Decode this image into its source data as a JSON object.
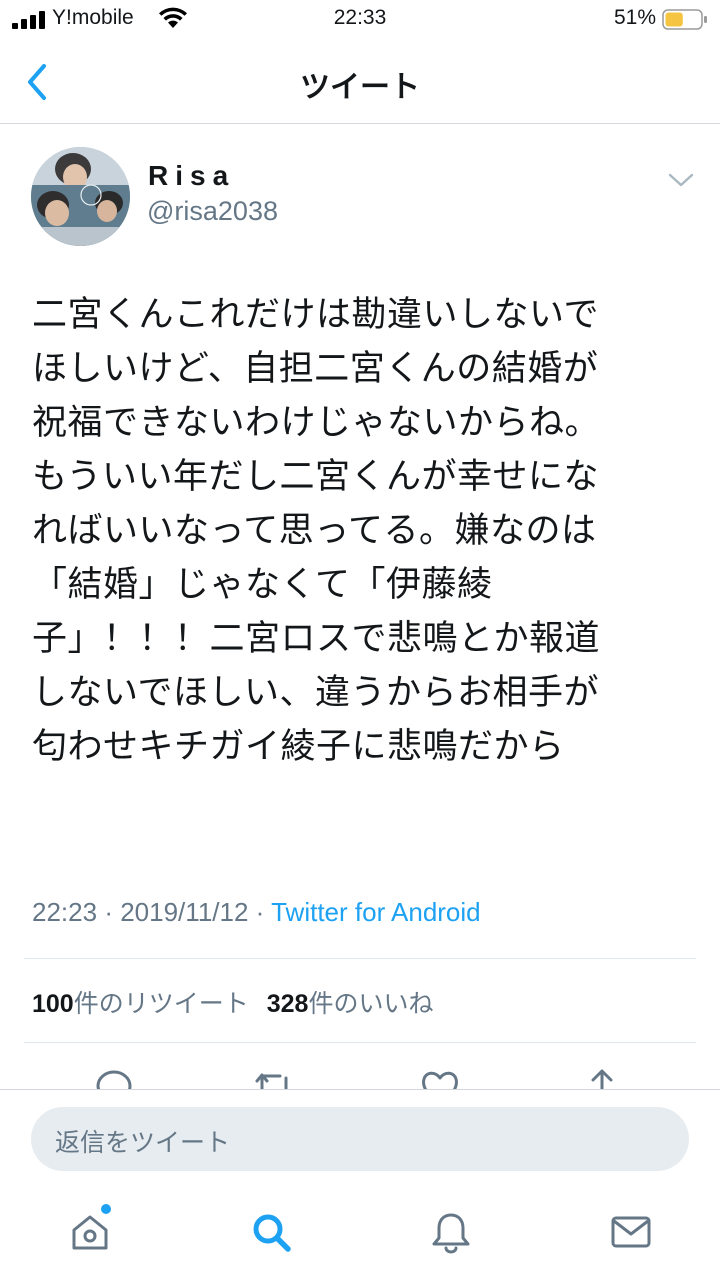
{
  "status_bar": {
    "carrier": "Y!mobile",
    "time": "22:33",
    "battery_percent": "51%",
    "battery_level": 0.51,
    "battery_color": "#f5c542"
  },
  "nav": {
    "title": "ツイート",
    "back_icon": "chevron-left-icon"
  },
  "tweet": {
    "display_name": "Risa",
    "handle": "@risa2038",
    "text_lines": [
      "二宮くんこれだけは勘違いしないで",
      "ほしいけど、自担二宮くんの結婚が",
      "祝福できないわけじゃないからね。",
      "もういい年だし二宮くんが幸せにな",
      "ればいいなって思ってる。嫌なのは",
      "「結婚」じゃなくて「伊藤綾",
      "子」！！！二宮ロスで悲鳴とか報道",
      "しないでほしい、違うからお相手が",
      "匂わせキチガイ綾子に悲鳴だから"
    ],
    "time": "22:23",
    "date": "2019/11/12",
    "separator": "·",
    "source": "Twitter for Android",
    "retweet_count": "100",
    "retweet_label": "件のリツイート",
    "like_count": "328",
    "like_label": "件のいいね"
  },
  "reply": {
    "placeholder": "返信をツイート"
  },
  "colors": {
    "accent": "#1da1f2",
    "secondary_text": "#657786",
    "divider": "#e1e8ed"
  },
  "icons": {
    "actions": [
      "reply-icon",
      "retweet-icon",
      "like-icon",
      "share-icon"
    ],
    "tabs": [
      "home-icon",
      "search-icon",
      "notifications-icon",
      "messages-icon"
    ]
  }
}
